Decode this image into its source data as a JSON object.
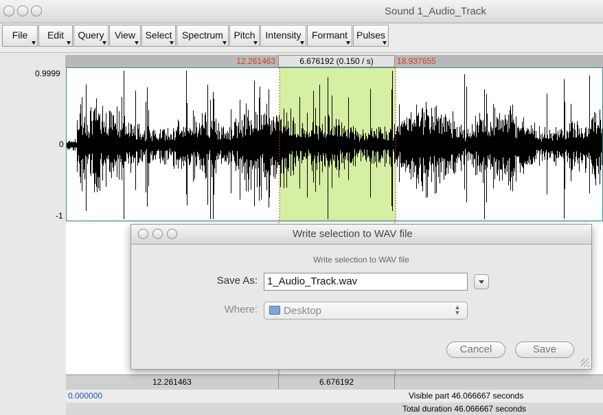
{
  "window": {
    "title": "Sound 1_Audio_Track"
  },
  "menu": [
    "File",
    "Edit",
    "Query",
    "View",
    "Select",
    "Spectrum",
    "Pitch",
    "Intensity",
    "Formant",
    "Pulses"
  ],
  "selection_bar": {
    "start": "12.261463",
    "duration": "6.676192 (0.150 / s)",
    "end": "18.937655"
  },
  "waveform": {
    "y_top": "0.9999",
    "y_zero": "0",
    "y_bottom": "-1",
    "selection_color": "#d6efa3",
    "selection_line_color": "#e03a10"
  },
  "bottom_bar": {
    "start": "12.261463",
    "duration": "6.676192"
  },
  "status": {
    "visible_start": "0.000000",
    "visible_part": "Visible part 46.066667 seconds",
    "total_duration": "Total duration 46.066667 seconds"
  },
  "dialog": {
    "title": "Write selection to WAV file",
    "subtitle": "Write selection to WAV file",
    "save_as_label": "Save As:",
    "filename": "1_Audio_Track.wav",
    "where_label": "Where:",
    "where_value": "Desktop",
    "cancel_label": "Cancel",
    "save_label": "Save"
  }
}
